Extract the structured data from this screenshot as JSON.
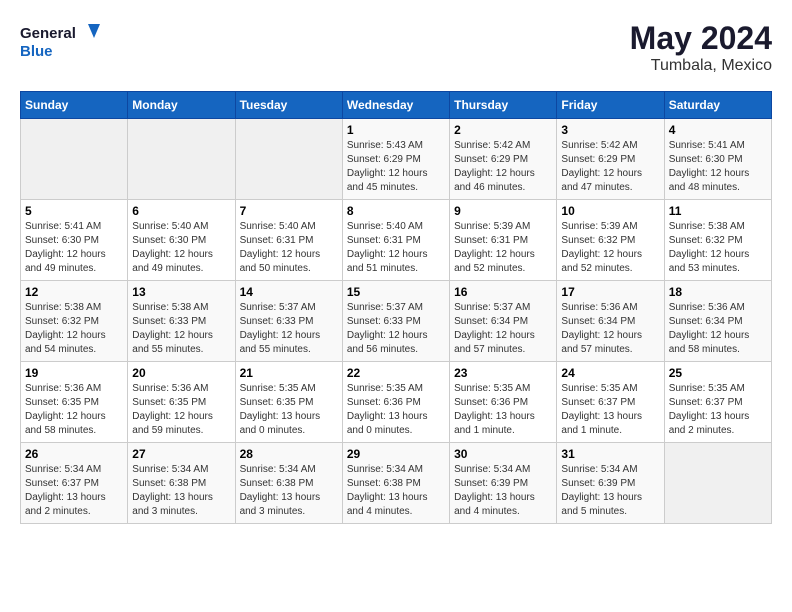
{
  "header": {
    "logo_general": "General",
    "logo_blue": "Blue",
    "month": "May 2024",
    "location": "Tumbala, Mexico"
  },
  "days_of_week": [
    "Sunday",
    "Monday",
    "Tuesday",
    "Wednesday",
    "Thursday",
    "Friday",
    "Saturday"
  ],
  "weeks": [
    [
      {
        "day": "",
        "sunrise": "",
        "sunset": "",
        "daylight": ""
      },
      {
        "day": "",
        "sunrise": "",
        "sunset": "",
        "daylight": ""
      },
      {
        "day": "",
        "sunrise": "",
        "sunset": "",
        "daylight": ""
      },
      {
        "day": "1",
        "sunrise": "Sunrise: 5:43 AM",
        "sunset": "Sunset: 6:29 PM",
        "daylight": "Daylight: 12 hours and 45 minutes."
      },
      {
        "day": "2",
        "sunrise": "Sunrise: 5:42 AM",
        "sunset": "Sunset: 6:29 PM",
        "daylight": "Daylight: 12 hours and 46 minutes."
      },
      {
        "day": "3",
        "sunrise": "Sunrise: 5:42 AM",
        "sunset": "Sunset: 6:29 PM",
        "daylight": "Daylight: 12 hours and 47 minutes."
      },
      {
        "day": "4",
        "sunrise": "Sunrise: 5:41 AM",
        "sunset": "Sunset: 6:30 PM",
        "daylight": "Daylight: 12 hours and 48 minutes."
      }
    ],
    [
      {
        "day": "5",
        "sunrise": "Sunrise: 5:41 AM",
        "sunset": "Sunset: 6:30 PM",
        "daylight": "Daylight: 12 hours and 49 minutes."
      },
      {
        "day": "6",
        "sunrise": "Sunrise: 5:40 AM",
        "sunset": "Sunset: 6:30 PM",
        "daylight": "Daylight: 12 hours and 49 minutes."
      },
      {
        "day": "7",
        "sunrise": "Sunrise: 5:40 AM",
        "sunset": "Sunset: 6:31 PM",
        "daylight": "Daylight: 12 hours and 50 minutes."
      },
      {
        "day": "8",
        "sunrise": "Sunrise: 5:40 AM",
        "sunset": "Sunset: 6:31 PM",
        "daylight": "Daylight: 12 hours and 51 minutes."
      },
      {
        "day": "9",
        "sunrise": "Sunrise: 5:39 AM",
        "sunset": "Sunset: 6:31 PM",
        "daylight": "Daylight: 12 hours and 52 minutes."
      },
      {
        "day": "10",
        "sunrise": "Sunrise: 5:39 AM",
        "sunset": "Sunset: 6:32 PM",
        "daylight": "Daylight: 12 hours and 52 minutes."
      },
      {
        "day": "11",
        "sunrise": "Sunrise: 5:38 AM",
        "sunset": "Sunset: 6:32 PM",
        "daylight": "Daylight: 12 hours and 53 minutes."
      }
    ],
    [
      {
        "day": "12",
        "sunrise": "Sunrise: 5:38 AM",
        "sunset": "Sunset: 6:32 PM",
        "daylight": "Daylight: 12 hours and 54 minutes."
      },
      {
        "day": "13",
        "sunrise": "Sunrise: 5:38 AM",
        "sunset": "Sunset: 6:33 PM",
        "daylight": "Daylight: 12 hours and 55 minutes."
      },
      {
        "day": "14",
        "sunrise": "Sunrise: 5:37 AM",
        "sunset": "Sunset: 6:33 PM",
        "daylight": "Daylight: 12 hours and 55 minutes."
      },
      {
        "day": "15",
        "sunrise": "Sunrise: 5:37 AM",
        "sunset": "Sunset: 6:33 PM",
        "daylight": "Daylight: 12 hours and 56 minutes."
      },
      {
        "day": "16",
        "sunrise": "Sunrise: 5:37 AM",
        "sunset": "Sunset: 6:34 PM",
        "daylight": "Daylight: 12 hours and 57 minutes."
      },
      {
        "day": "17",
        "sunrise": "Sunrise: 5:36 AM",
        "sunset": "Sunset: 6:34 PM",
        "daylight": "Daylight: 12 hours and 57 minutes."
      },
      {
        "day": "18",
        "sunrise": "Sunrise: 5:36 AM",
        "sunset": "Sunset: 6:34 PM",
        "daylight": "Daylight: 12 hours and 58 minutes."
      }
    ],
    [
      {
        "day": "19",
        "sunrise": "Sunrise: 5:36 AM",
        "sunset": "Sunset: 6:35 PM",
        "daylight": "Daylight: 12 hours and 58 minutes."
      },
      {
        "day": "20",
        "sunrise": "Sunrise: 5:36 AM",
        "sunset": "Sunset: 6:35 PM",
        "daylight": "Daylight: 12 hours and 59 minutes."
      },
      {
        "day": "21",
        "sunrise": "Sunrise: 5:35 AM",
        "sunset": "Sunset: 6:35 PM",
        "daylight": "Daylight: 13 hours and 0 minutes."
      },
      {
        "day": "22",
        "sunrise": "Sunrise: 5:35 AM",
        "sunset": "Sunset: 6:36 PM",
        "daylight": "Daylight: 13 hours and 0 minutes."
      },
      {
        "day": "23",
        "sunrise": "Sunrise: 5:35 AM",
        "sunset": "Sunset: 6:36 PM",
        "daylight": "Daylight: 13 hours and 1 minute."
      },
      {
        "day": "24",
        "sunrise": "Sunrise: 5:35 AM",
        "sunset": "Sunset: 6:37 PM",
        "daylight": "Daylight: 13 hours and 1 minute."
      },
      {
        "day": "25",
        "sunrise": "Sunrise: 5:35 AM",
        "sunset": "Sunset: 6:37 PM",
        "daylight": "Daylight: 13 hours and 2 minutes."
      }
    ],
    [
      {
        "day": "26",
        "sunrise": "Sunrise: 5:34 AM",
        "sunset": "Sunset: 6:37 PM",
        "daylight": "Daylight: 13 hours and 2 minutes."
      },
      {
        "day": "27",
        "sunrise": "Sunrise: 5:34 AM",
        "sunset": "Sunset: 6:38 PM",
        "daylight": "Daylight: 13 hours and 3 minutes."
      },
      {
        "day": "28",
        "sunrise": "Sunrise: 5:34 AM",
        "sunset": "Sunset: 6:38 PM",
        "daylight": "Daylight: 13 hours and 3 minutes."
      },
      {
        "day": "29",
        "sunrise": "Sunrise: 5:34 AM",
        "sunset": "Sunset: 6:38 PM",
        "daylight": "Daylight: 13 hours and 4 minutes."
      },
      {
        "day": "30",
        "sunrise": "Sunrise: 5:34 AM",
        "sunset": "Sunset: 6:39 PM",
        "daylight": "Daylight: 13 hours and 4 minutes."
      },
      {
        "day": "31",
        "sunrise": "Sunrise: 5:34 AM",
        "sunset": "Sunset: 6:39 PM",
        "daylight": "Daylight: 13 hours and 5 minutes."
      },
      {
        "day": "",
        "sunrise": "",
        "sunset": "",
        "daylight": ""
      }
    ]
  ]
}
